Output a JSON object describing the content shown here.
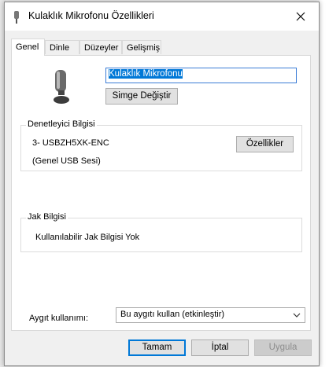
{
  "window": {
    "title": "Kulaklık Mikrofonu Özellikleri",
    "close_icon": "close-icon"
  },
  "tabs": [
    {
      "label": "Genel",
      "active": true
    },
    {
      "label": "Dinle",
      "active": false
    },
    {
      "label": "Düzeyler",
      "active": false
    },
    {
      "label": "Gelişmiş",
      "active": false
    }
  ],
  "general": {
    "device_name_value": "Kulaklık Mikrofonu",
    "change_icon_label": "Simge Değiştir",
    "controller": {
      "group_label": "Denetleyici Bilgisi",
      "line1": "3- USBZH5XK-ENC",
      "line2": "(Genel USB Sesi)",
      "properties_label": "Özellikler"
    },
    "jack": {
      "group_label": "Jak Bilgisi",
      "text": "Kullanılabilir Jak Bilgisi Yok"
    },
    "device_usage": {
      "label": "Aygıt kullanımı:",
      "selected": "Bu aygıtı kullan (etkinleştir)"
    }
  },
  "footer": {
    "ok_label": "Tamam",
    "cancel_label": "İptal",
    "apply_label": "Uygula"
  },
  "colors": {
    "accent": "#0078d7",
    "disabled_text": "#8d8d8d"
  }
}
